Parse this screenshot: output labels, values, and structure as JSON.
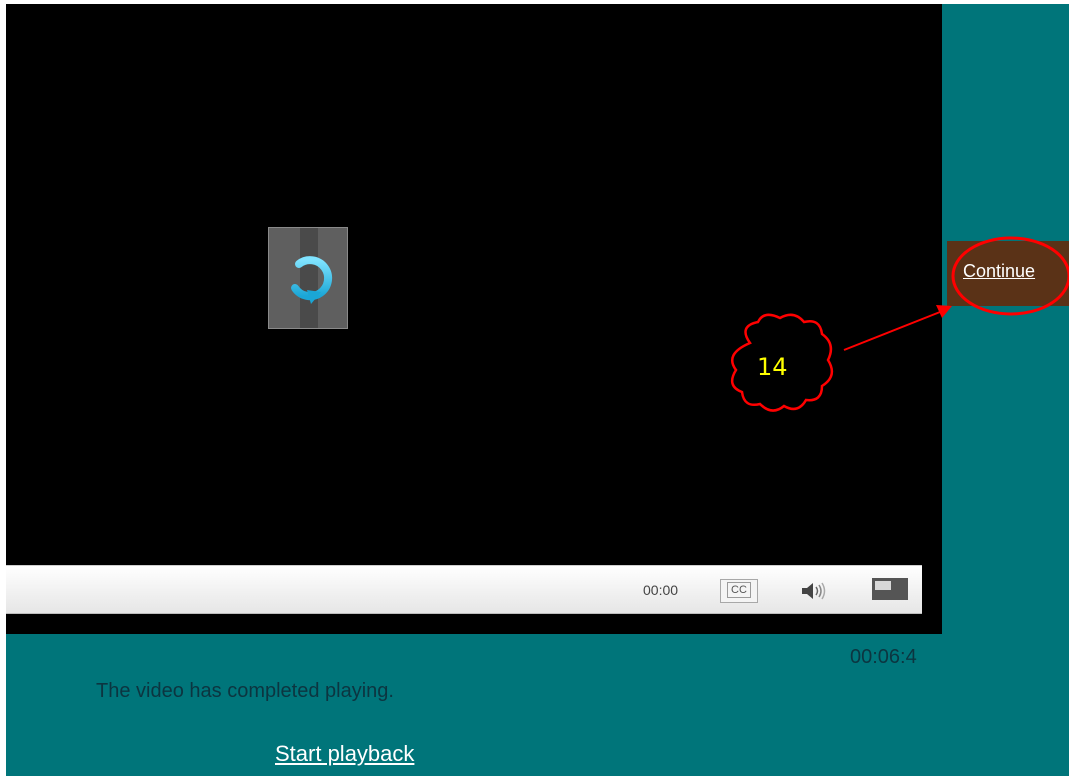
{
  "player": {
    "controls": {
      "time_display": "00:00",
      "cc_label": "CC",
      "volume_icon": "speaker-icon",
      "size_icon": "resize-icon"
    },
    "replay_icon": "replay-icon"
  },
  "timecode": "00:06:4",
  "status_message": "The video has completed playing.",
  "start_playback_link": "Start playback",
  "continue_link": "Continue",
  "annotation": {
    "step_number": "14",
    "color": "#ff0000",
    "number_color": "#ffff00"
  },
  "colors": {
    "page_background": "#00757a",
    "video_background": "#000000",
    "continue_panel": "#5a3217",
    "text_dark": "#0c3540"
  }
}
